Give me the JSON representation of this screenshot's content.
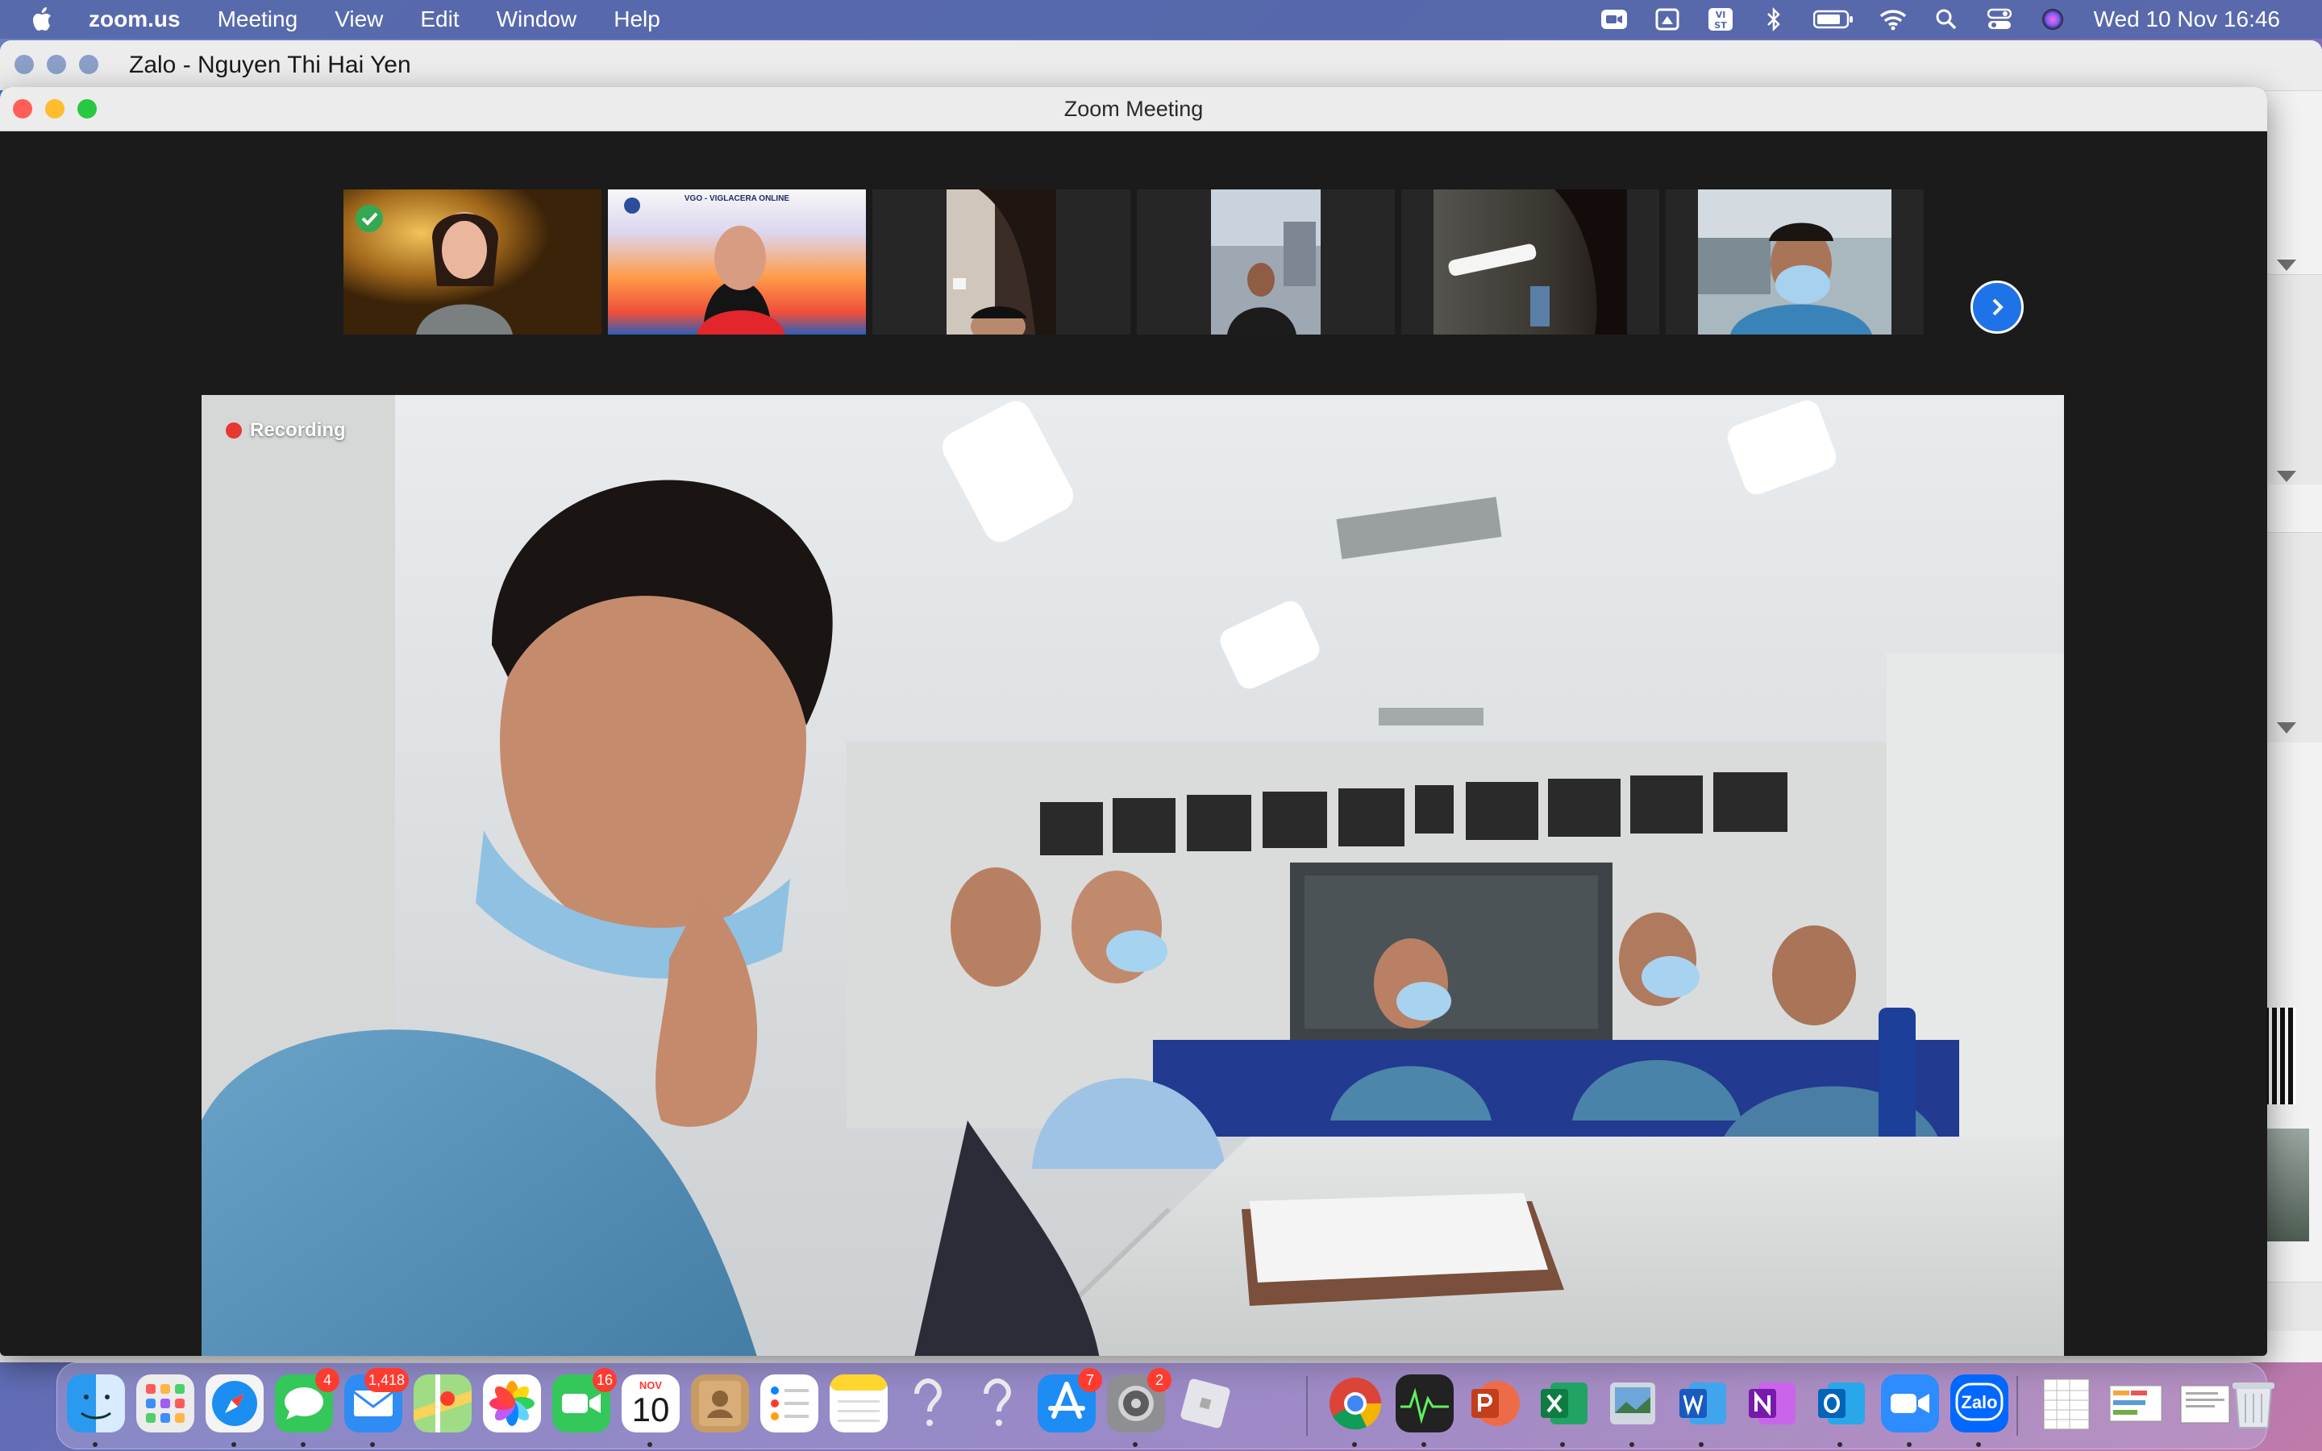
{
  "menubar": {
    "app_name": "zoom.us",
    "items": [
      "Meeting",
      "View",
      "Edit",
      "Window",
      "Help"
    ],
    "clock": "Wed 10 Nov  16:46",
    "tray_vn_label": "VI\nST"
  },
  "zalo_window": {
    "title": "Zalo - Nguyen Thi Hai Yen"
  },
  "zoom_window": {
    "title": "Zoom Meeting",
    "participant_banner_text": "VGO - VIGLACERA ONLINE",
    "recording_label": "Recording"
  },
  "dock": {
    "badges": {
      "messages": "4",
      "mail": "1,418",
      "facetime": "16",
      "app_store": "7",
      "system_preferences": "2"
    },
    "calendar": {
      "month": "NOV",
      "day": "10"
    },
    "zalo_label": "Zalo"
  },
  "colors": {
    "menubar": "#5668aa",
    "zoom_accent": "#1f73e8",
    "recording": "#e8382f"
  }
}
